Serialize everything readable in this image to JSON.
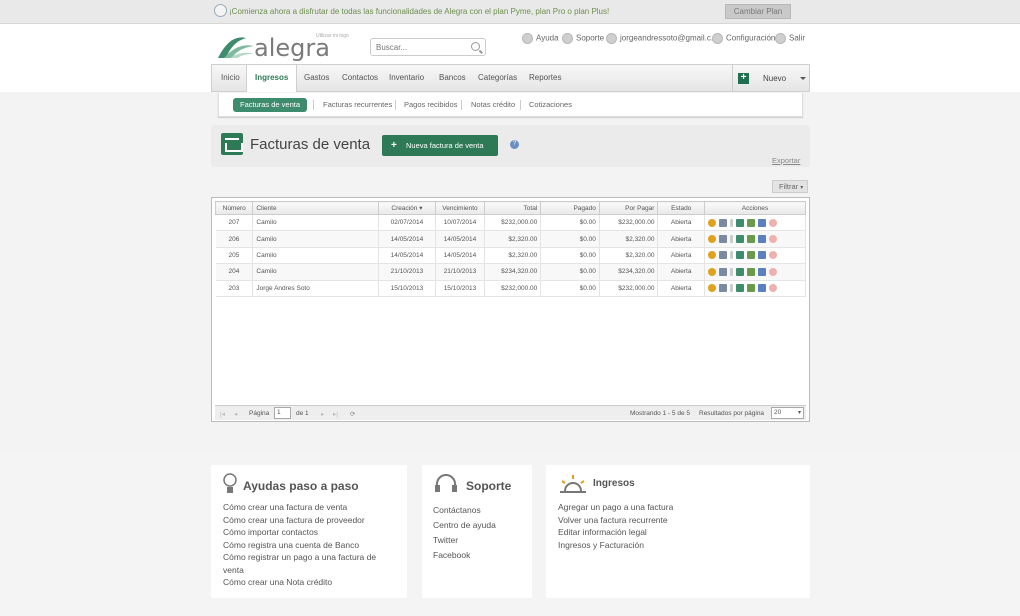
{
  "banner": {
    "message": "¡Comienza ahora a disfrutar de todas las funcionalidades de Alegra con el plan Pyme, plan Pro o plan Plus!",
    "button": "Cambiar Plan"
  },
  "logo": {
    "text": "alegra",
    "sub": "Utilizar mi logo"
  },
  "search": {
    "placeholder": "Buscar..."
  },
  "toplinks": {
    "help": "Ayuda",
    "support": "Soporte",
    "email": "jorgeandressoto@gmail.c...",
    "config": "Configuración",
    "logout": "Salir"
  },
  "nav": {
    "items": [
      "Inicio",
      "Ingresos",
      "Gastos",
      "Contactos",
      "Inventario",
      "Bancos",
      "Categorías",
      "Reportes"
    ],
    "nuevo": "Nuevo"
  },
  "subnav": {
    "items": [
      "Facturas de venta",
      "Facturas recurrentes",
      "Pagos recibidos",
      "Notas crédito",
      "Cotizaciones"
    ]
  },
  "page": {
    "title": "Facturas de venta",
    "new_button": "Nueva factura de venta",
    "export": "Exportar",
    "filter": "Filtrar"
  },
  "table": {
    "headers": [
      "Número",
      "Cliente",
      "Creación",
      "Vencimiento",
      "Total",
      "Pagado",
      "Por Pagar",
      "Estado",
      "Acciones"
    ],
    "rows": [
      {
        "num": "207",
        "client": "Camilo",
        "created": "02/07/2014",
        "due": "10/07/2014",
        "total": "$232,000.00",
        "paid": "$0.00",
        "due_amt": "$232,000.00",
        "status": "Abierta"
      },
      {
        "num": "206",
        "client": "Camilo",
        "created": "14/05/2014",
        "due": "14/05/2014",
        "total": "$2,320.00",
        "paid": "$0.00",
        "due_amt": "$2,320.00",
        "status": "Abierta"
      },
      {
        "num": "205",
        "client": "Camilo",
        "created": "14/05/2014",
        "due": "14/05/2014",
        "total": "$2,320.00",
        "paid": "$0.00",
        "due_amt": "$2,320.00",
        "status": "Abierta"
      },
      {
        "num": "204",
        "client": "Camilo",
        "created": "21/10/2013",
        "due": "21/10/2013",
        "total": "$234,320.00",
        "paid": "$0.00",
        "due_amt": "$234,320.00",
        "status": "Abierta"
      },
      {
        "num": "203",
        "client": "Jorge Andres Soto",
        "created": "15/10/2013",
        "due": "15/10/2013",
        "total": "$232,000.00",
        "paid": "$0.00",
        "due_amt": "$232,000.00",
        "status": "Abierta"
      }
    ]
  },
  "pager": {
    "page_label": "Página",
    "page": "1",
    "of": "de 1",
    "showing": "Mostrando 1 - 5 de 5",
    "per_page_label": "Resultados por página",
    "per_page": "20"
  },
  "footer": {
    "ayudas": {
      "title": "Ayudas paso a paso",
      "links": [
        "Cómo crear una factura de venta",
        "Cómo crear una factura de proveedor",
        "Cómo importar contactos",
        "Cómo registra una cuenta de Banco",
        "Cómo registrar un pago a una factura de venta",
        "Cómo crear una Nota crédito"
      ]
    },
    "soporte": {
      "title": "Soporte",
      "links": [
        "Contáctanos",
        "Centro de ayuda",
        "Twitter",
        "Facebook"
      ]
    },
    "ingresos": {
      "title": "Ingresos",
      "links": [
        "Agregar un pago a una factura",
        "Volver una factura recurrente",
        "Editar información legal",
        "Ingresos y Facturación"
      ]
    }
  },
  "colors": {
    "brand": "#2f7a56",
    "link_blue": "#3a6fb8",
    "overdue_red": "#c0392b"
  }
}
